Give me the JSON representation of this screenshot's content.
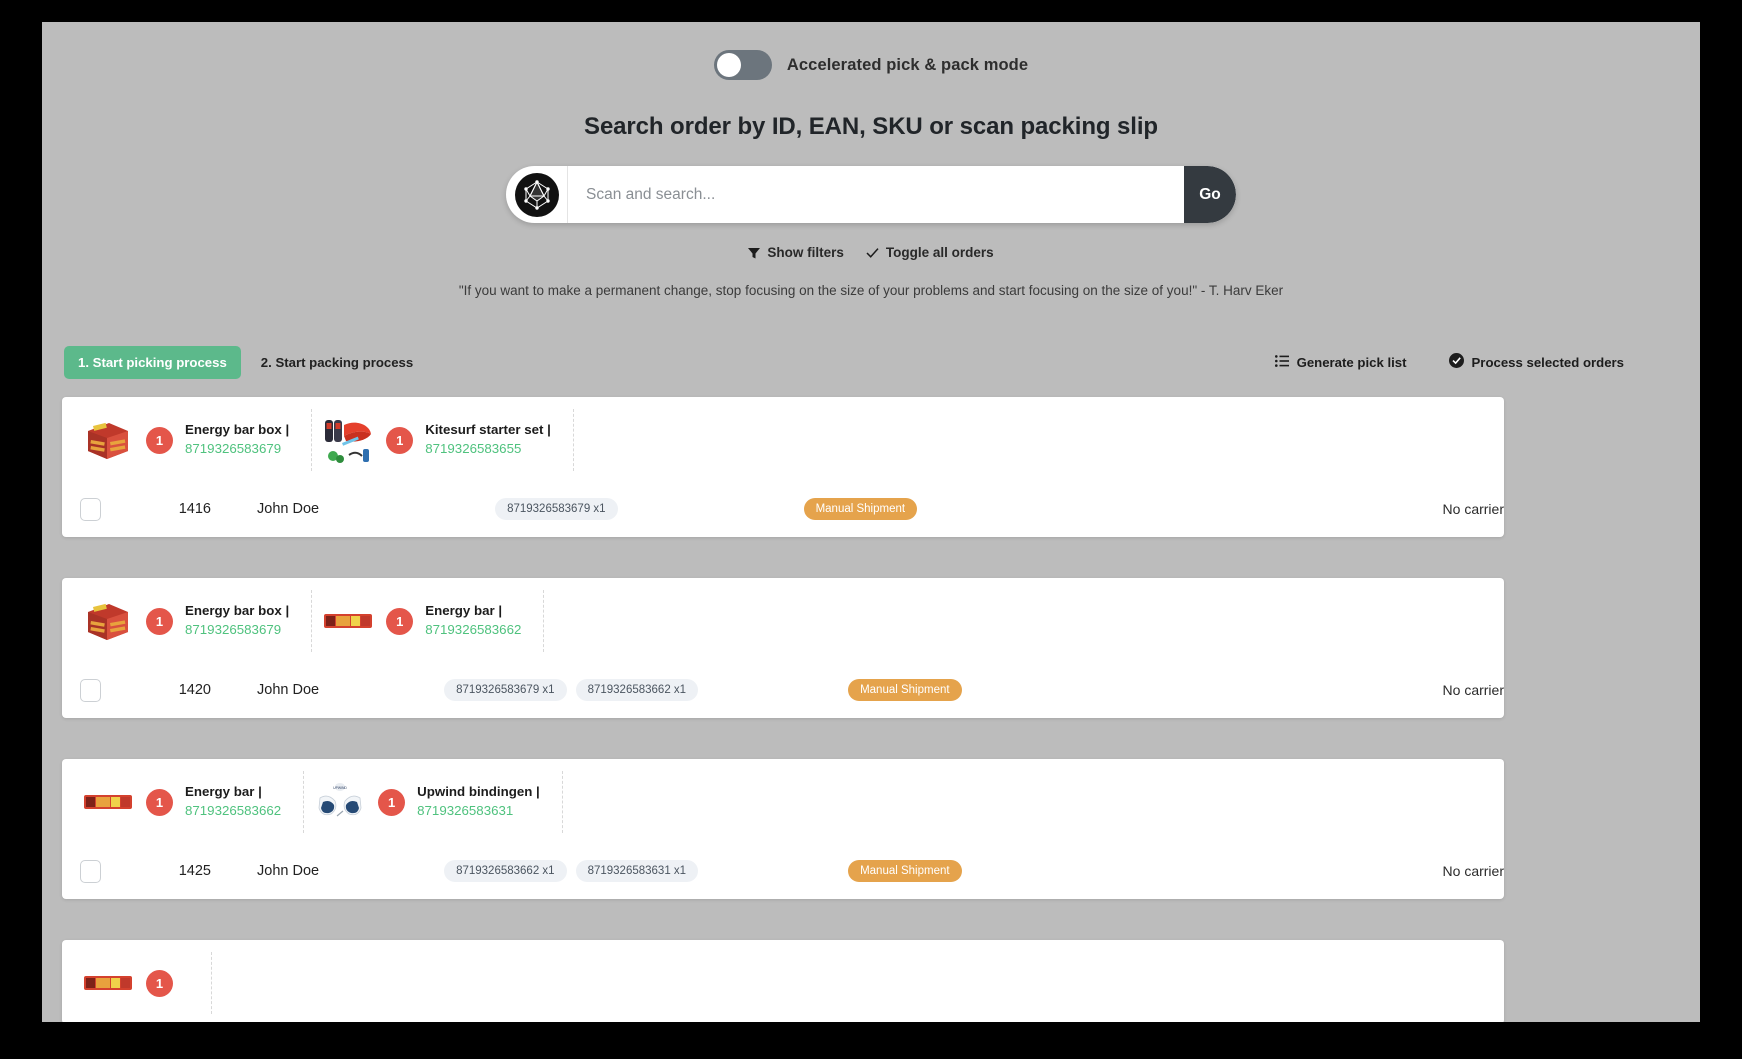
{
  "accelerated_toggle": {
    "label": "Accelerated pick & pack mode",
    "state": "off"
  },
  "heading": "Search order by ID, EAN, SKU or scan packing slip",
  "search": {
    "placeholder": "Scan and search...",
    "value": "",
    "go_label": "Go",
    "logo_icon": "octahedron-logo-icon"
  },
  "filters": {
    "show_filters_label": "Show filters",
    "show_filters_icon": "funnel-icon",
    "toggle_all_label": "Toggle all orders",
    "toggle_all_icon": "check-icon"
  },
  "quote": "\"If you want to make a permanent change, stop focusing on the size of your problems and start focusing on the size of you!\" - T. Harv Eker",
  "actions": {
    "picking_label": "1. Start picking process",
    "packing_label": "2. Start packing process",
    "generate_pick_list_label": "Generate pick list",
    "generate_pick_list_icon": "list-icon",
    "process_selected_label": "Process selected orders",
    "process_selected_icon": "check-circle-icon",
    "accent_green": "#5cb98b"
  },
  "colors": {
    "page_bg": "#bcbcbc",
    "card_bg": "#ffffff",
    "ean_green": "#4fc27e",
    "qty_red": "#e4564a",
    "shipment_orange": "#e5a34c",
    "go_dark": "#343a40"
  },
  "orders": [
    {
      "id": "1416",
      "customer": "John Doe",
      "shipment_badge": "Manual Shipment",
      "carrier": "No carrier",
      "checked": false,
      "products": [
        {
          "name": "Energy bar box |",
          "ean": "8719326583679",
          "qty": "1",
          "thumb": "energy-bar-box-image"
        },
        {
          "name": "Kitesurf starter set |",
          "ean": "8719326583655",
          "qty": "1",
          "thumb": "kitesurf-starter-set-image"
        }
      ],
      "ean_chips": [
        "8719326583679 x1"
      ]
    },
    {
      "id": "1420",
      "customer": "John Doe",
      "shipment_badge": "Manual Shipment",
      "carrier": "No carrier",
      "checked": false,
      "products": [
        {
          "name": "Energy bar box |",
          "ean": "8719326583679",
          "qty": "1",
          "thumb": "energy-bar-box-image"
        },
        {
          "name": "Energy bar |",
          "ean": "8719326583662",
          "qty": "1",
          "thumb": "energy-bar-image"
        }
      ],
      "ean_chips": [
        "8719326583679 x1",
        "8719326583662 x1"
      ]
    },
    {
      "id": "1425",
      "customer": "John Doe",
      "shipment_badge": "Manual Shipment",
      "carrier": "No carrier",
      "checked": false,
      "products": [
        {
          "name": "Energy bar |",
          "ean": "8719326583662",
          "qty": "1",
          "thumb": "energy-bar-image"
        },
        {
          "name": "Upwind bindingen |",
          "ean": "8719326583631",
          "qty": "1",
          "thumb": "upwind-bindings-image"
        }
      ],
      "ean_chips": [
        "8719326583662 x1",
        "8719326583631 x1"
      ]
    }
  ]
}
